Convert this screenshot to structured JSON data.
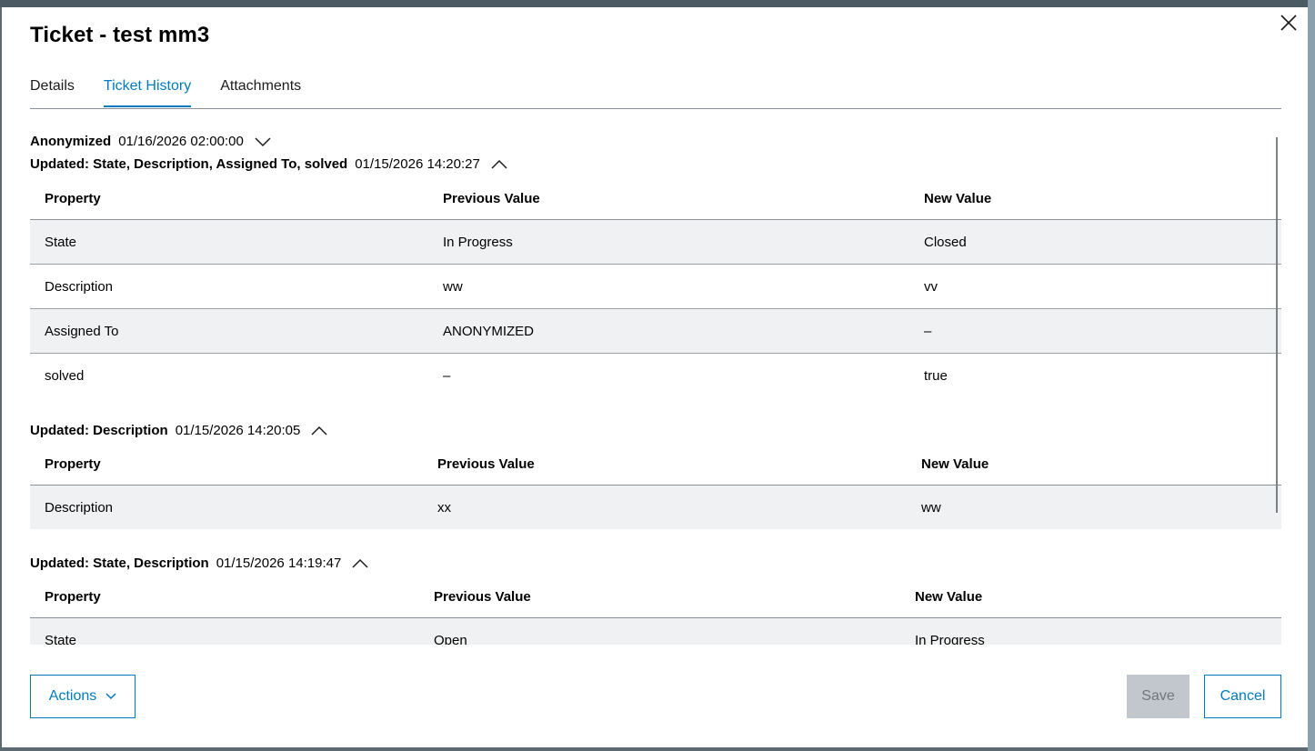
{
  "dialog": {
    "title": "Ticket - test mm3"
  },
  "tabs": [
    {
      "label": "Details"
    },
    {
      "label": "Ticket History"
    },
    {
      "label": "Attachments"
    }
  ],
  "active_tab": "Ticket History",
  "table_headers": {
    "property": "Property",
    "previous": "Previous Value",
    "new": "New Value"
  },
  "history": [
    {
      "label": "Anonymized",
      "timestamp": "01/16/2026 02:00:00",
      "expanded": false,
      "rows": []
    },
    {
      "label": "Updated: State, Description, Assigned To, solved",
      "timestamp": "01/15/2026 14:20:27",
      "expanded": true,
      "rows": [
        {
          "property": "State",
          "previous": "In Progress",
          "new": "Closed"
        },
        {
          "property": "Description",
          "previous": "ww",
          "new": "vv"
        },
        {
          "property": "Assigned To",
          "previous": "ANONYMIZED",
          "new": "–"
        },
        {
          "property": "solved",
          "previous": "–",
          "new": "true"
        }
      ]
    },
    {
      "label": "Updated: Description",
      "timestamp": "01/15/2026 14:20:05",
      "expanded": true,
      "rows": [
        {
          "property": "Description",
          "previous": "xx",
          "new": "ww"
        }
      ]
    },
    {
      "label": "Updated: State, Description",
      "timestamp": "01/15/2026 14:19:47",
      "expanded": true,
      "rows": [
        {
          "property": "State",
          "previous": "Open",
          "new": "In Progress"
        }
      ]
    }
  ],
  "footer": {
    "actions_label": "Actions",
    "save_label": "Save",
    "cancel_label": "Cancel"
  },
  "colors": {
    "accent": "#007bc0",
    "row_stripe": "#eff1f2",
    "disabled_button": "#c1c7cc"
  }
}
